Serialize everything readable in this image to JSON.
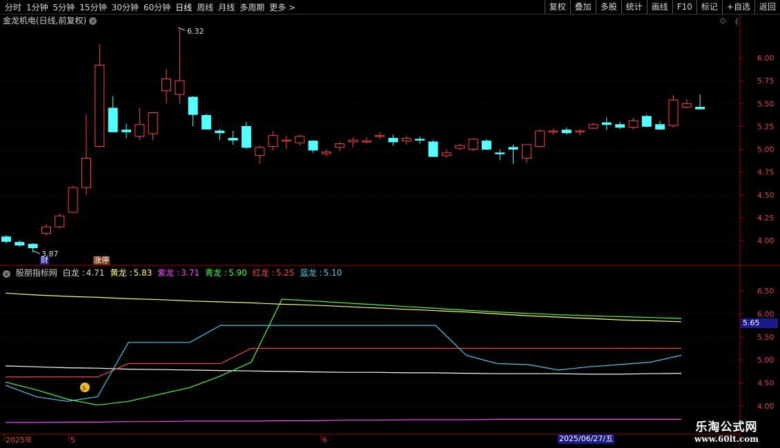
{
  "toolbar": {
    "periods": [
      "分时",
      "1分钟",
      "5分钟",
      "15分钟",
      "30分钟",
      "60分钟",
      "日线",
      "周线",
      "月线",
      "多周期",
      "更多 >"
    ],
    "active_period": "日线",
    "actions": [
      "复权",
      "叠加",
      "多股",
      "统计",
      "画线",
      "F10",
      "+自选",
      "返回"
    ],
    "marker_label": "标记"
  },
  "main_chart": {
    "title": "金龙机电(日线,前复权)",
    "dropdown_glyph": "v",
    "ctrl_icons": [
      "◇",
      "〈"
    ],
    "y_ticks": [
      "6.00",
      "5.75",
      "5.50",
      "5.25",
      "5.00",
      "4.75",
      "4.50",
      "4.25",
      "4.00"
    ],
    "high_label": "6.32",
    "low_label": "3.87",
    "tag_cai": "财",
    "tag_zhangting": "涨停"
  },
  "indicator": {
    "name": "股朋指标网",
    "lines": [
      {
        "name": "白龙",
        "value": "4.71",
        "color": "#ffffff"
      },
      {
        "name": "黄龙",
        "value": "5.83",
        "color": "#ffff66"
      },
      {
        "name": "紫龙",
        "value": "3.71",
        "color": "#ff44ff"
      },
      {
        "name": "青龙",
        "value": "5.90",
        "color": "#44ff44"
      },
      {
        "name": "红龙",
        "value": "5.25",
        "color": "#ff4444"
      },
      {
        "name": "蓝龙",
        "value": "5.10",
        "color": "#44ccee"
      }
    ],
    "y_ticks": [
      "6.50",
      "6.00",
      "5.50",
      "5.00",
      "4.50",
      "4.00"
    ],
    "current_price": "5.65",
    "money_icon": "money-bag-icon"
  },
  "x_axis": {
    "labels": [
      "2025年",
      "5",
      "6"
    ],
    "cursor_date": "2025/06/27/五"
  },
  "watermark": {
    "line1": "乐淘公式网",
    "line2": "www.60lt.com"
  },
  "colors": {
    "up": "#ff4444",
    "down": "#55ffff",
    "grid": "#8b0000",
    "axis": "#aa0000"
  },
  "chart_data": {
    "type": "candlestick",
    "candles": [
      [
        4.04,
        4.06,
        3.97,
        3.99
      ],
      [
        3.98,
        4.0,
        3.93,
        3.95
      ],
      [
        3.96,
        3.97,
        3.87,
        3.92
      ],
      [
        4.08,
        4.18,
        4.05,
        4.15
      ],
      [
        4.15,
        4.3,
        4.13,
        4.27
      ],
      [
        4.31,
        4.6,
        4.3,
        4.58
      ],
      [
        4.58,
        5.38,
        4.5,
        4.9
      ],
      [
        5.03,
        6.15,
        5.03,
        5.92
      ],
      [
        5.45,
        5.58,
        5.2,
        5.19
      ],
      [
        5.21,
        5.28,
        5.12,
        5.19
      ],
      [
        5.14,
        5.45,
        5.1,
        5.27
      ],
      [
        5.17,
        5.32,
        5.1,
        5.4
      ],
      [
        5.64,
        5.88,
        5.5,
        5.77
      ],
      [
        5.6,
        6.32,
        5.5,
        5.75
      ],
      [
        5.57,
        5.58,
        5.25,
        5.38
      ],
      [
        5.37,
        5.39,
        5.22,
        5.22
      ],
      [
        5.2,
        5.22,
        5.1,
        5.18
      ],
      [
        5.12,
        5.2,
        5.05,
        5.1
      ],
      [
        5.25,
        5.3,
        5.0,
        5.02
      ],
      [
        4.93,
        5.04,
        4.84,
        5.02
      ],
      [
        5.03,
        5.2,
        4.99,
        5.15
      ],
      [
        5.1,
        5.15,
        5.0,
        5.1
      ],
      [
        5.07,
        5.16,
        5.04,
        5.14
      ],
      [
        5.09,
        5.09,
        4.96,
        4.99
      ],
      [
        4.95,
        5.0,
        4.92,
        4.97
      ],
      [
        5.02,
        5.08,
        4.98,
        5.06
      ],
      [
        5.08,
        5.13,
        5.02,
        5.1
      ],
      [
        5.09,
        5.13,
        5.06,
        5.09
      ],
      [
        5.14,
        5.19,
        5.11,
        5.15
      ],
      [
        5.12,
        5.16,
        5.04,
        5.08
      ],
      [
        5.09,
        5.15,
        5.05,
        5.12
      ],
      [
        5.11,
        5.14,
        5.06,
        5.1
      ],
      [
        5.08,
        5.1,
        4.92,
        4.92
      ],
      [
        4.93,
        5.0,
        4.9,
        4.96
      ],
      [
        5.01,
        5.06,
        4.99,
        5.04
      ],
      [
        5.0,
        5.12,
        4.98,
        5.11
      ],
      [
        5.09,
        5.11,
        4.99,
        5.0
      ],
      [
        4.96,
        5.0,
        4.88,
        4.95
      ],
      [
        5.02,
        5.05,
        4.84,
        5.0
      ],
      [
        4.9,
        5.05,
        4.85,
        5.05
      ],
      [
        5.03,
        5.22,
        5.02,
        5.2
      ],
      [
        5.19,
        5.22,
        5.16,
        5.2
      ],
      [
        5.21,
        5.24,
        5.16,
        5.18
      ],
      [
        5.19,
        5.22,
        5.15,
        5.2
      ],
      [
        5.23,
        5.29,
        5.22,
        5.27
      ],
      [
        5.29,
        5.35,
        5.21,
        5.27
      ],
      [
        5.27,
        5.3,
        5.22,
        5.24
      ],
      [
        5.24,
        5.34,
        5.22,
        5.31
      ],
      [
        5.36,
        5.38,
        5.24,
        5.25
      ],
      [
        5.27,
        5.31,
        5.21,
        5.22
      ],
      [
        5.26,
        5.59,
        5.24,
        5.54
      ],
      [
        5.46,
        5.55,
        5.45,
        5.5
      ],
      [
        5.46,
        5.6,
        5.45,
        5.44
      ]
    ],
    "indicator_series": {
      "白龙": [
        4.87,
        4.85,
        4.83,
        4.82,
        4.8,
        4.79,
        4.78,
        4.77,
        4.76,
        4.75,
        4.74,
        4.73,
        4.73,
        4.72,
        4.72,
        4.71,
        4.7,
        4.7,
        4.7,
        4.69,
        4.69,
        4.7,
        4.71
      ],
      "黄龙": [
        6.45,
        6.41,
        6.38,
        6.36,
        6.33,
        6.31,
        6.28,
        6.26,
        6.24,
        6.21,
        6.19,
        6.16,
        6.13,
        6.1,
        6.07,
        6.04,
        6.0,
        5.96,
        5.93,
        5.9,
        5.87,
        5.85,
        5.83
      ],
      "紫龙": [
        3.64,
        3.64,
        3.65,
        3.65,
        3.66,
        3.66,
        3.67,
        3.67,
        3.67,
        3.68,
        3.68,
        3.69,
        3.69,
        3.7,
        3.7,
        3.7,
        3.71,
        3.71,
        3.71,
        3.71,
        3.71,
        3.71,
        3.71
      ],
      "青龙": [
        4.52,
        4.35,
        4.15,
        4.02,
        4.1,
        4.25,
        4.4,
        4.65,
        4.95,
        6.32,
        6.28,
        6.24,
        6.2,
        6.16,
        6.12,
        6.08,
        6.04,
        6.01,
        5.98,
        5.96,
        5.94,
        5.92,
        5.9
      ],
      "红龙": [
        4.63,
        4.63,
        4.63,
        4.63,
        4.92,
        4.92,
        4.92,
        4.92,
        5.25,
        5.25,
        5.25,
        5.25,
        5.25,
        5.25,
        5.25,
        5.25,
        5.25,
        5.25,
        5.25,
        5.25,
        5.25,
        5.25,
        5.25
      ],
      "蓝龙": [
        4.45,
        4.2,
        4.1,
        4.2,
        5.38,
        5.38,
        5.38,
        5.75,
        5.75,
        5.75,
        5.75,
        5.75,
        5.75,
        5.75,
        5.75,
        5.1,
        4.92,
        4.9,
        4.78,
        4.85,
        4.9,
        4.95,
        5.1
      ]
    }
  }
}
